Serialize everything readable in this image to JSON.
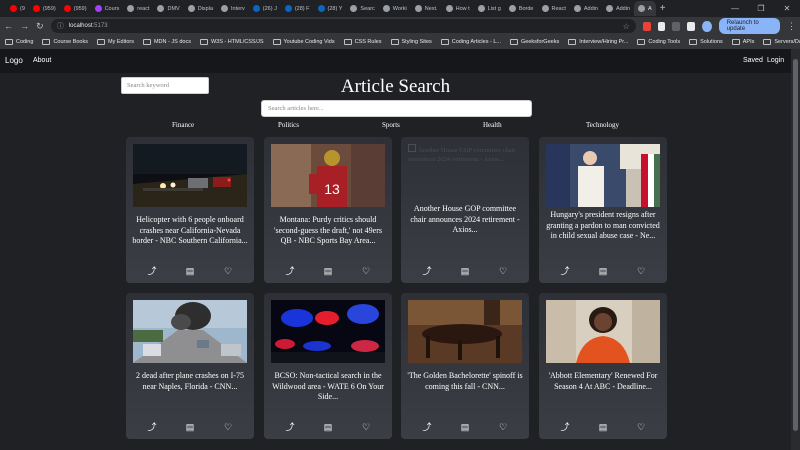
{
  "browser": {
    "tabs": [
      {
        "label": "(9",
        "color": "#ff0000"
      },
      {
        "label": "(959)",
        "color": "#ff0000"
      },
      {
        "label": "(959)",
        "color": "#ff0000"
      },
      {
        "label": "Cours",
        "color": "#a142f4"
      },
      {
        "label": "react",
        "color": "#9aa0a6"
      },
      {
        "label": "DMV",
        "color": "#9aa0a6"
      },
      {
        "label": "Displa",
        "color": "#9aa0a6"
      },
      {
        "label": "Interv",
        "color": "#9aa0a6"
      },
      {
        "label": "(26) J",
        "color": "#0a66c2"
      },
      {
        "label": "(28) F",
        "color": "#0a66c2"
      },
      {
        "label": "(28) Y",
        "color": "#0a66c2"
      },
      {
        "label": "Searc",
        "color": "#9aa0a6"
      },
      {
        "label": "Worki",
        "color": "#9aa0a6"
      },
      {
        "label": "Next.",
        "color": "#9aa0a6"
      },
      {
        "label": "How t",
        "color": "#9aa0a6"
      },
      {
        "label": "List g",
        "color": "#9aa0a6"
      },
      {
        "label": "Borde",
        "color": "#9aa0a6"
      },
      {
        "label": "React",
        "color": "#9aa0a6"
      },
      {
        "label": "Addin",
        "color": "#9aa0a6"
      },
      {
        "label": "Addin",
        "color": "#9aa0a6"
      },
      {
        "label": "A",
        "color": "#9aa0a6",
        "active": true
      }
    ],
    "url_host": "localhost",
    "url_port": ":5173",
    "relaunch_label": "Relaunch to update",
    "extension_colors": [
      "#ea4335",
      "#e8eaed",
      "#5f6368",
      "#e8eaed"
    ],
    "bookmarks": [
      "Coding",
      "Course Books",
      "My Editors",
      "MDN - JS docs",
      "W3S - HTML/CSS/JS",
      "Youtube Coding Vids",
      "CSS Rules",
      "Styling Sites",
      "Coding Articles - L...",
      "GeeksforGeeks",
      "Interview/Hiring Pr...",
      "Coding Tools",
      "Solutions",
      "APIs",
      "Servers/Databases"
    ]
  },
  "nav": {
    "logo": "Logo",
    "about": "About",
    "saved": "Saved",
    "login": "Login"
  },
  "keyword_placeholder": "Search keyword",
  "heading": "Article Search",
  "search_placeholder": "Search articles here...",
  "categories": [
    "Finance",
    "Politics",
    "Sports",
    "Health",
    "Technology"
  ],
  "icons": {
    "share": "share-icon",
    "comment": "comment-icon",
    "like": "heart-icon"
  },
  "articles": [
    {
      "title": "Helicopter with 6 people onboard crashes near California-Nevada border - NBC Southern California...",
      "image": "helicopter crash night scene"
    },
    {
      "title": "Montana: Purdy critics should 'second-guess the draft,' not 49ers QB - NBC Sports Bay Area...",
      "image": "49ers quarterback number 13"
    },
    {
      "title": "Another House GOP committee chair announces 2024 retirement - Axios...",
      "image": "",
      "broken_alt": "Another House GOP committee chair announces 2024 retirement - Axios..."
    },
    {
      "title": "Hungary's president resigns after granting a pardon to man convicted in child sexual abuse case - Ne...",
      "image": "Hungary's president at podium with flags"
    },
    {
      "title": "2 dead after plane crashes on I-75 near Naples, Florida - CNN...",
      "image": "smoke over highway"
    },
    {
      "title": "BCSO: Non-tactical search in the Wildwood area - WATE 6 On Your Side...",
      "image": "police lights"
    },
    {
      "title": "'The Golden Bachelorette' spinoff is coming this fall - CNN...",
      "image": "The Golden Bachelorette"
    },
    {
      "title": "'Abbott Elementary' Renewed For Season 4 At ABC - Deadline...",
      "image": "Abbott Elementary actress"
    }
  ]
}
